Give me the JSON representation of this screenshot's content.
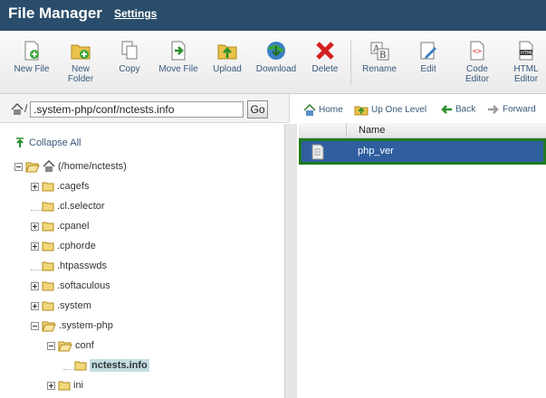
{
  "header": {
    "title": "File Manager",
    "settings": "Settings"
  },
  "toolbar": [
    {
      "label": "New File",
      "icon": "new-file-icon"
    },
    {
      "label": "New\nFolder",
      "icon": "new-folder-icon"
    },
    {
      "label": "Copy",
      "icon": "copy-icon"
    },
    {
      "label": "Move File",
      "icon": "move-file-icon"
    },
    {
      "label": "Upload",
      "icon": "upload-icon"
    },
    {
      "label": "Download",
      "icon": "download-icon"
    },
    {
      "label": "Delete",
      "icon": "delete-icon"
    },
    {
      "label": "Rename",
      "icon": "rename-icon"
    },
    {
      "label": "Edit",
      "icon": "edit-icon"
    },
    {
      "label": "Code\nEditor",
      "icon": "code-editor-icon"
    },
    {
      "label": "HTML\nEditor",
      "icon": "html-editor-icon"
    }
  ],
  "path": {
    "slash": "/",
    "value": ".system-php/conf/nctests.info",
    "go": "Go"
  },
  "nav": {
    "home": "Home",
    "up": "Up One Level",
    "back": "Back",
    "forward": "Forward"
  },
  "tree": {
    "collapse_all": "Collapse All",
    "root": "(/home/nctests)",
    "items": [
      {
        "label": ".cagefs"
      },
      {
        "label": ".cl.selector"
      },
      {
        "label": ".cpanel"
      },
      {
        "label": ".cphorde"
      },
      {
        "label": ".htpasswds"
      },
      {
        "label": ".softaculous"
      },
      {
        "label": ".system"
      },
      {
        "label": ".system-php"
      },
      {
        "label": "conf"
      },
      {
        "label": "nctests.info"
      },
      {
        "label": "ini"
      }
    ]
  },
  "table": {
    "header_name": "Name",
    "rows": [
      {
        "name": "php_ver"
      }
    ]
  },
  "colors": {
    "header_bg": "#2a4d6b",
    "selected_row": "#2f5f9f",
    "highlight_border": "#1f7a1f"
  }
}
